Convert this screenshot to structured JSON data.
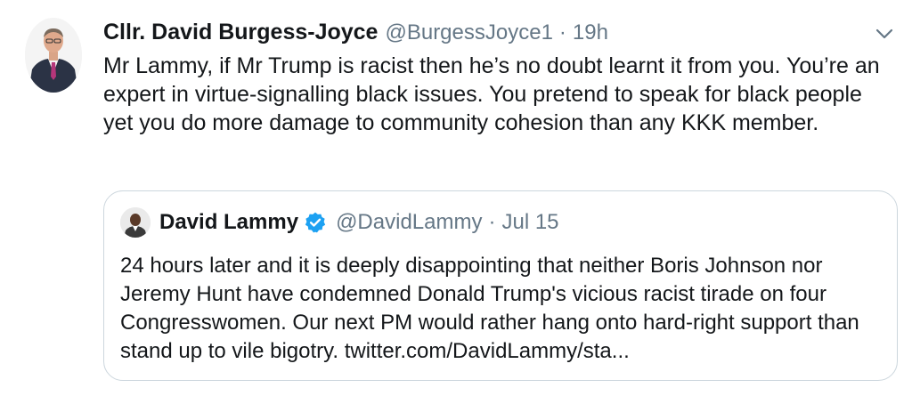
{
  "tweet": {
    "author": {
      "display_name": "Cllr. David Burgess-Joyce",
      "handle": "@BurgessJoyce1",
      "separator": "·",
      "time": "19h"
    },
    "text": "Mr Lammy, if Mr Trump is racist then he’s no doubt learnt it from you. You’re an expert in virtue-signalling black issues. You pretend to speak for black people yet you do more damage to community cohesion than any KKK member.",
    "menu_icon": "chevron-down-icon"
  },
  "quote": {
    "author": {
      "display_name": "David Lammy",
      "handle": "@DavidLammy",
      "separator": "·",
      "time": "Jul 15",
      "verified_icon": "verified-badge-icon"
    },
    "text": "24 hours later and it is deeply disappointing that neither Boris Johnson nor Jeremy Hunt have condemned Donald Trump's vicious racist tirade on four Congresswomen. Our next PM would rather hang onto hard-right support than stand up to vile bigotry. twitter.com/DavidLammy/sta..."
  },
  "colors": {
    "primary_text": "#14171a",
    "secondary_text": "#657786",
    "border": "#ccd6dd",
    "verified_blue": "#1da1f2"
  }
}
